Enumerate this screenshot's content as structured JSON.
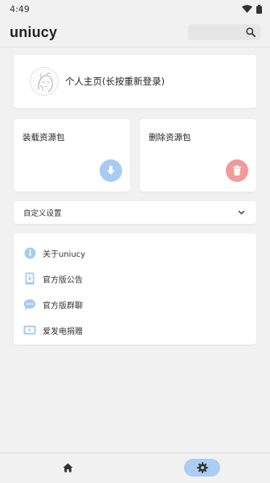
{
  "status": {
    "time": "4:49"
  },
  "app": {
    "title": "uniucy"
  },
  "search": {
    "placeholder": ""
  },
  "profile": {
    "label": "个人主页(长按重新登录)"
  },
  "packs": {
    "load_label": "装载资源包",
    "delete_label": "删除资源包"
  },
  "custom": {
    "label": "自定义设置"
  },
  "links": [
    {
      "label": "关于uniucy",
      "icon": "info-icon"
    },
    {
      "label": "官方版公告",
      "icon": "phone-download-icon"
    },
    {
      "label": "官方版群聊",
      "icon": "chat-bubble-icon"
    },
    {
      "label": "爱发电捐赠",
      "icon": "video-card-icon"
    }
  ],
  "nav": {
    "items": [
      {
        "icon": "home-icon"
      },
      {
        "icon": "settings-icon",
        "selected": true
      }
    ]
  },
  "colors": {
    "accent_blue": "#a7cbf3",
    "delete_red": "#f29a9a",
    "background": "#f1f1f1",
    "card": "#ffffff"
  }
}
